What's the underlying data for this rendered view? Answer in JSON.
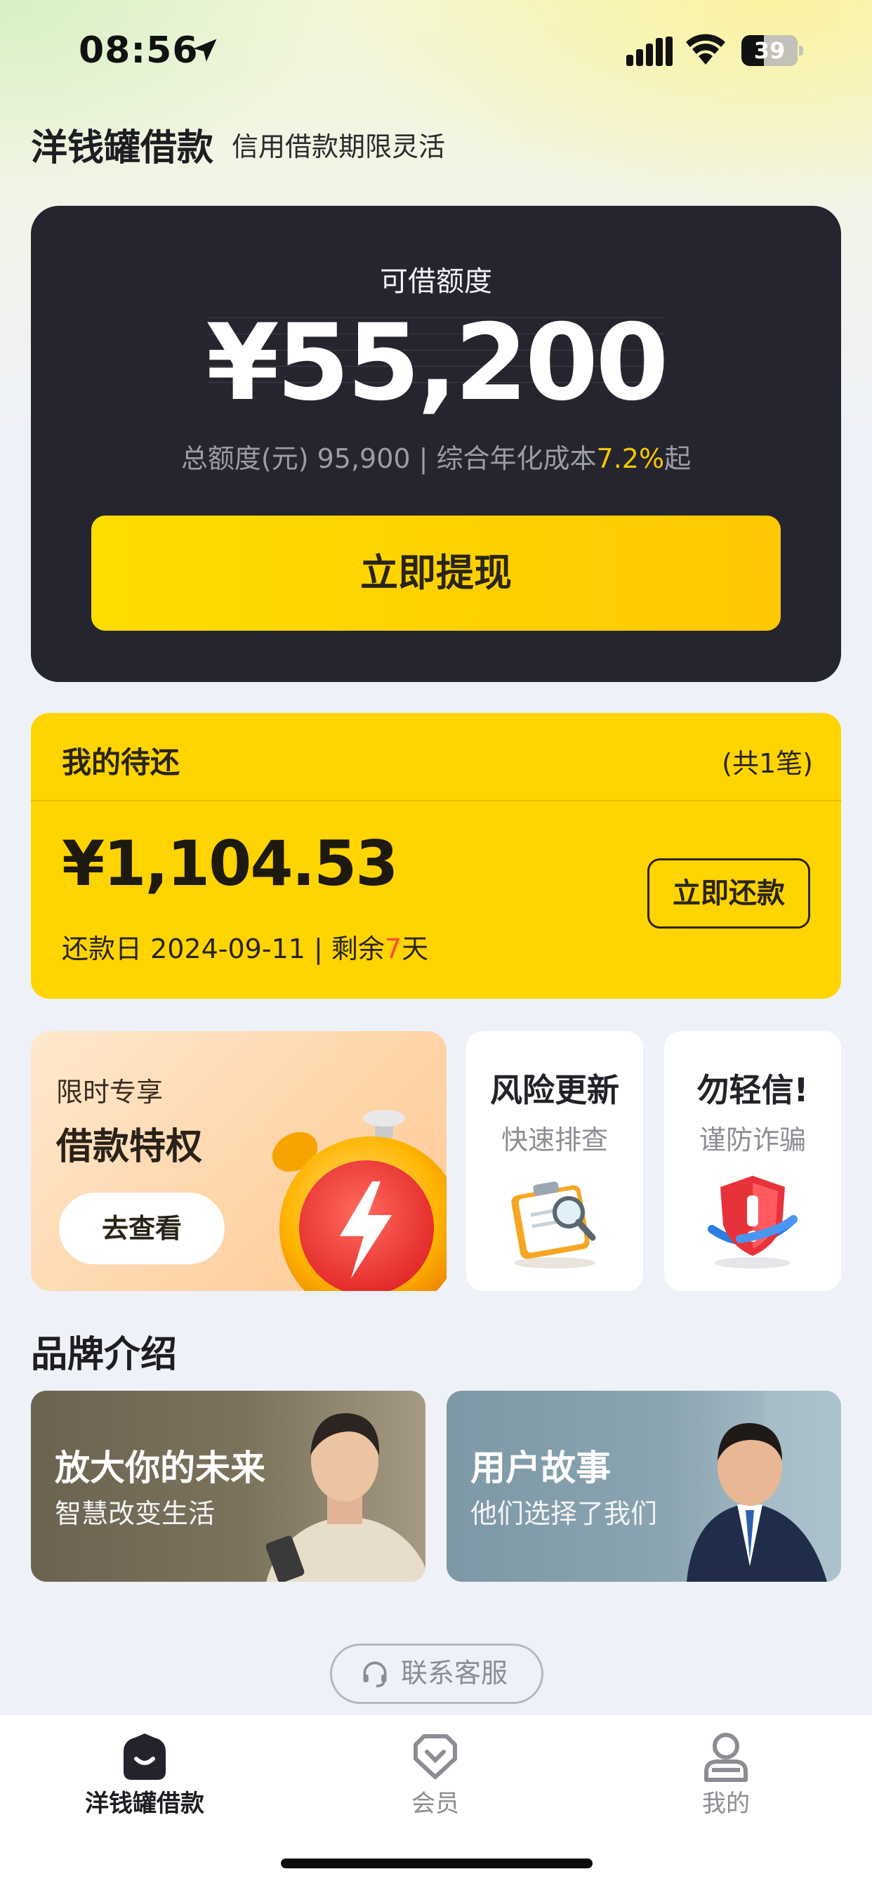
{
  "status_bar": {
    "time": "08:56",
    "battery": "39",
    "icons": [
      "location-arrow-icon",
      "cellular-signal-icon",
      "wifi-icon",
      "battery-icon"
    ]
  },
  "header": {
    "title": "洋钱罐借款",
    "subtitle": "信用借款期限灵活"
  },
  "credit": {
    "label": "可借额度",
    "amount": "¥55,200",
    "info_prefix": "总额度(元) 95,900 | 综合年化成本",
    "rate": "7.2%",
    "info_suffix": "起",
    "withdraw_label": "立即提现"
  },
  "repayment": {
    "title": "我的待还",
    "count": "(共1笔)",
    "amount": "¥1,104.53",
    "date_prefix": "还款日 2024-09-11 | 剩余",
    "days": "7",
    "date_suffix": "天",
    "button_label": "立即还款"
  },
  "promo": {
    "small_label": "限时专享",
    "big_label": "借款特权",
    "button_label": "去查看",
    "icon": "alarm-clock-lightning-icon"
  },
  "tiles": [
    {
      "title": "风险更新",
      "subtitle": "快速排查",
      "icon": "clipboard-magnifier-icon"
    },
    {
      "title": "勿轻信!",
      "subtitle": "谨防诈骗",
      "icon": "shield-warning-icon"
    }
  ],
  "brand": {
    "heading": "品牌介绍",
    "cards": [
      {
        "title": "放大你的未来",
        "subtitle": "智慧改变生活"
      },
      {
        "title": "用户故事",
        "subtitle": "他们选择了我们"
      }
    ]
  },
  "customer_service": {
    "label": "联系客服",
    "icon": "headset-icon"
  },
  "tabbar": {
    "items": [
      {
        "label": "洋钱罐借款",
        "icon": "home-bag-icon",
        "active": true
      },
      {
        "label": "会员",
        "icon": "member-badge-icon",
        "active": false
      },
      {
        "label": "我的",
        "icon": "profile-icon",
        "active": false
      }
    ]
  },
  "colors": {
    "accent_yellow": "#ffd400",
    "card_dark": "#24252e",
    "rate_color": "#f7c600",
    "days_color": "#ff4a3a"
  }
}
